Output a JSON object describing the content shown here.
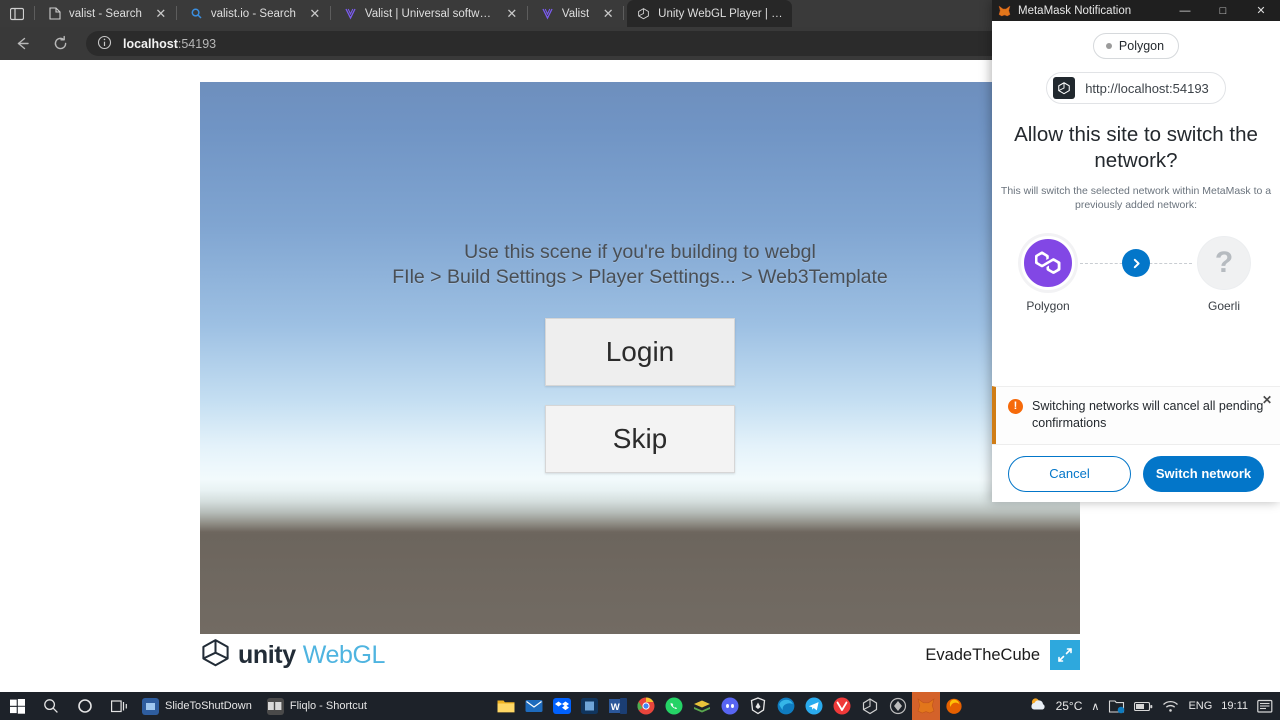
{
  "browser": {
    "tabs": [
      {
        "favicon": "page-icon",
        "title": "valist - Search",
        "close": "✕",
        "active": false
      },
      {
        "favicon": "bing-icon",
        "title": "valist.io - Search",
        "close": "✕",
        "active": false
      },
      {
        "favicon": "valist-icon",
        "title": "Valist | Universal software deploy",
        "close": "✕",
        "active": false
      },
      {
        "favicon": "valist-icon",
        "title": "Valist",
        "close": "✕",
        "active": false
      },
      {
        "favicon": "unity-icon",
        "title": "Unity WebGL Player | EvadeT",
        "close": "✕",
        "active": true
      }
    ],
    "tab_overview_label": "tab-overview",
    "nav": {
      "back": "←",
      "reload": "⟳"
    },
    "omnibox": {
      "host": "localhost",
      "path": ":54193",
      "info_icon": "info-icon",
      "read_aloud_icon": "read-aloud-icon",
      "zoom_icon": "zoom-icon",
      "favorites_icon": "add-favorite-icon"
    },
    "extensions": [
      {
        "name": "opera-extension-icon",
        "color": "#e01b24"
      },
      {
        "name": "notes-extension-icon",
        "color": "#6aa84f"
      },
      {
        "name": "teal-extension-icon",
        "color": "#1ab6b6"
      }
    ]
  },
  "unity": {
    "hint_line1": "Use this scene if you're building to webgl",
    "hint_line2": "FIle > Build Settings > Player Settings... > Web3Template",
    "login_label": "Login",
    "skip_label": "Skip",
    "footer": {
      "logo_word": "unity",
      "logo_webgl": "WebGL",
      "title": "EvadeTheCube",
      "fullscreen_icon": "fullscreen-icon"
    }
  },
  "metamask": {
    "window_title": "MetaMask Notification",
    "minimize": "—",
    "maximize": "□",
    "close": "✕",
    "network_pill": "Polygon",
    "origin": "http://localhost:54193",
    "origin_favicon": "unity-icon",
    "heading": "Allow this site to switch the network?",
    "subtext": "This will switch the selected network within MetaMask to a previously added network:",
    "from_network": "Polygon",
    "to_network": "Goerli",
    "to_network_icon": "question-mark-icon",
    "arrow_icon": "chevron-right-icon",
    "alert": {
      "icon": "warning-icon",
      "text": "Switching networks will cancel all pending confirmations",
      "close": "✕"
    },
    "cancel_label": "Cancel",
    "confirm_label": "Switch network",
    "accent_blue": "#0376c9",
    "polygon_purple": "#8247e5",
    "warning_orange": "#f66a0a"
  },
  "taskbar": {
    "start_icon": "windows-start-icon",
    "search_icon": "search-icon",
    "cortana_icon": "cortana-icon",
    "taskview_icon": "task-view-icon",
    "tasks": [
      {
        "label": "SlideToShutDown",
        "icon": "slidetoshutdown-icon"
      },
      {
        "label": "Fliqlo - Shortcut",
        "icon": "fliqlo-icon"
      }
    ],
    "pinned": [
      {
        "name": "file-explorer-icon",
        "color": "#f0b323",
        "glyph": "▤"
      },
      {
        "name": "mail-icon",
        "color": "#1e6bbd",
        "glyph": "✉"
      },
      {
        "name": "dropbox-icon",
        "color": "#0061fe",
        "glyph": "❖"
      },
      {
        "name": "save-app-icon",
        "color": "#1b4f86",
        "glyph": "▣"
      },
      {
        "name": "word-icon",
        "color": "#2b579a",
        "glyph": "W"
      },
      {
        "name": "chrome-icon",
        "color": "#e8453c",
        "glyph": "●"
      },
      {
        "name": "whatsapp-icon",
        "color": "#25d366",
        "glyph": "✆"
      },
      {
        "name": "books-icon",
        "color": "#6aa84f",
        "glyph": "▬"
      },
      {
        "name": "discord-icon",
        "color": "#5865f2",
        "glyph": "●"
      },
      {
        "name": "brave-icon",
        "color": "#3b4252",
        "glyph": "◆"
      },
      {
        "name": "edge-icon",
        "color": "#0f7cc0",
        "glyph": "◔"
      },
      {
        "name": "telegram-icon",
        "color": "#2aabee",
        "glyph": "➤"
      },
      {
        "name": "vivaldi-icon",
        "color": "#ef3939",
        "glyph": "▼"
      },
      {
        "name": "unity-icon",
        "color": "#3a3a3a",
        "glyph": "◈"
      },
      {
        "name": "unity-hub-icon",
        "color": "#4a4a4a",
        "glyph": "◇"
      },
      {
        "name": "metamask-icon",
        "color": "#d4622a",
        "glyph": "▲"
      },
      {
        "name": "firefox-icon",
        "color": "#e66000",
        "glyph": "●"
      }
    ],
    "weather": {
      "icon": "partly-cloudy-icon",
      "temp": "25°C"
    },
    "tray": {
      "chevron": "∧",
      "onedrive_icon": "onedrive-icon",
      "battery_icon": "battery-icon",
      "wifi_icon": "wifi-icon",
      "language": "ENG",
      "time": "19:11",
      "notifications_icon": "notifications-icon"
    }
  }
}
